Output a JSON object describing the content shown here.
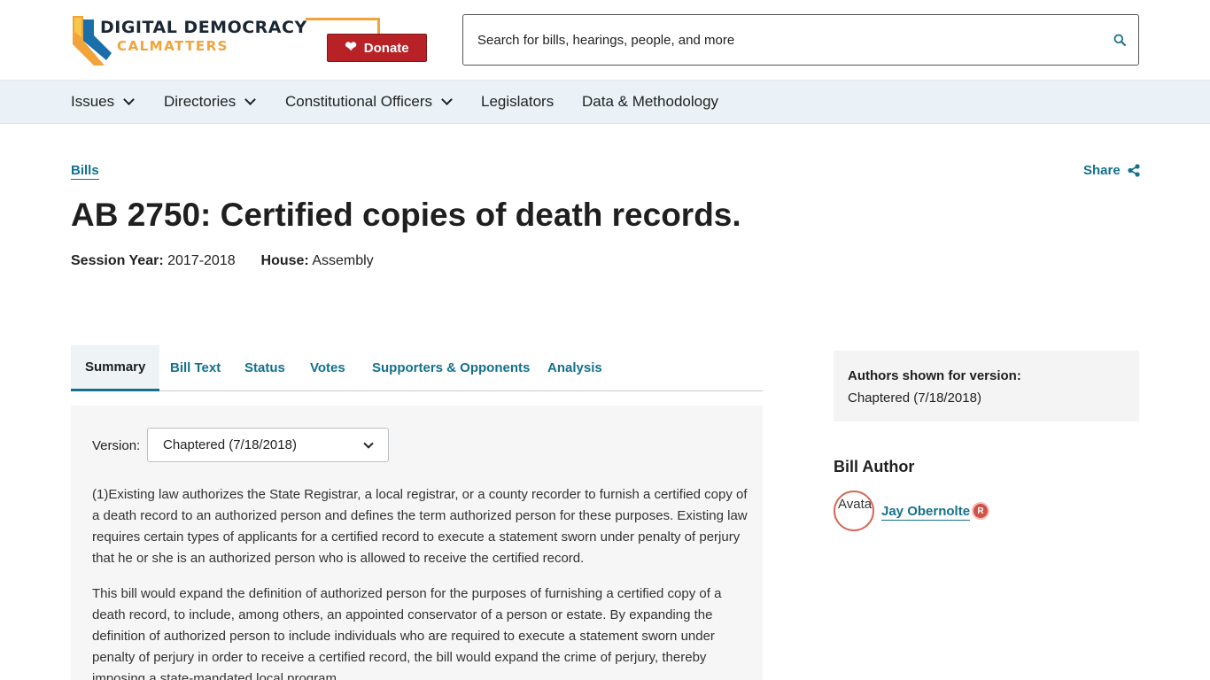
{
  "header": {
    "logo_line1": "DIGITAL DEMOCRACY",
    "logo_line2": "CALMATTERS",
    "donate_label": "Donate",
    "search_placeholder": "Search for bills, hearings, people, and more"
  },
  "nav": {
    "items": [
      {
        "label": "Issues",
        "has_dropdown": true
      },
      {
        "label": "Directories",
        "has_dropdown": true
      },
      {
        "label": "Constitutional Officers",
        "has_dropdown": true
      },
      {
        "label": "Legislators",
        "has_dropdown": false
      },
      {
        "label": "Data & Methodology",
        "has_dropdown": false
      }
    ]
  },
  "page": {
    "breadcrumb": "Bills",
    "share_label": "Share",
    "title": "AB 2750: Certified copies of death records.",
    "session_year_label": "Session Year:",
    "session_year": "2017-2018",
    "house_label": "House:",
    "house": "Assembly"
  },
  "tabs": [
    {
      "label": "Summary",
      "active": true
    },
    {
      "label": "Bill Text",
      "active": false
    },
    {
      "label": "Status",
      "active": false
    },
    {
      "label": "Votes",
      "active": false
    },
    {
      "label": "Supporters & Opponents",
      "active": false
    },
    {
      "label": "Analysis",
      "active": false
    }
  ],
  "summary": {
    "version_label": "Version:",
    "version_selected": "Chaptered (7/18/2018)",
    "paragraphs": [
      "(1)Existing law authorizes the State Registrar, a local registrar, or a county recorder to furnish a certified copy of a death record to an authorized person and defines the term authorized person for these purposes. Existing law requires certain types of applicants for a certified record to execute a statement sworn under penalty of perjury that he or she is an authorized person who is allowed to receive the certified record.",
      "This bill would expand the definition of authorized person for the purposes of furnishing a certified copy of a death record, to include, among others, an appointed conservator of a person or estate. By expanding the definition of authorized person to include individuals who are required to execute a statement sworn under penalty of perjury in order to receive a certified record, the bill would expand the crime of perjury, thereby imposing a state-mandated local program."
    ]
  },
  "sidebar": {
    "authors_version_title": "Authors shown for version:",
    "authors_version_value": "Chaptered (7/18/2018)",
    "bill_author_heading": "Bill Author",
    "avatar_alt": "Avatar",
    "author_name": "Jay Obernolte",
    "party": "R"
  },
  "colors": {
    "link": "#14708d",
    "donate": "#b82126",
    "nav_bg": "#eaf2f7",
    "accent_orange": "#f2a33a",
    "party_republican": "#d0534a"
  }
}
